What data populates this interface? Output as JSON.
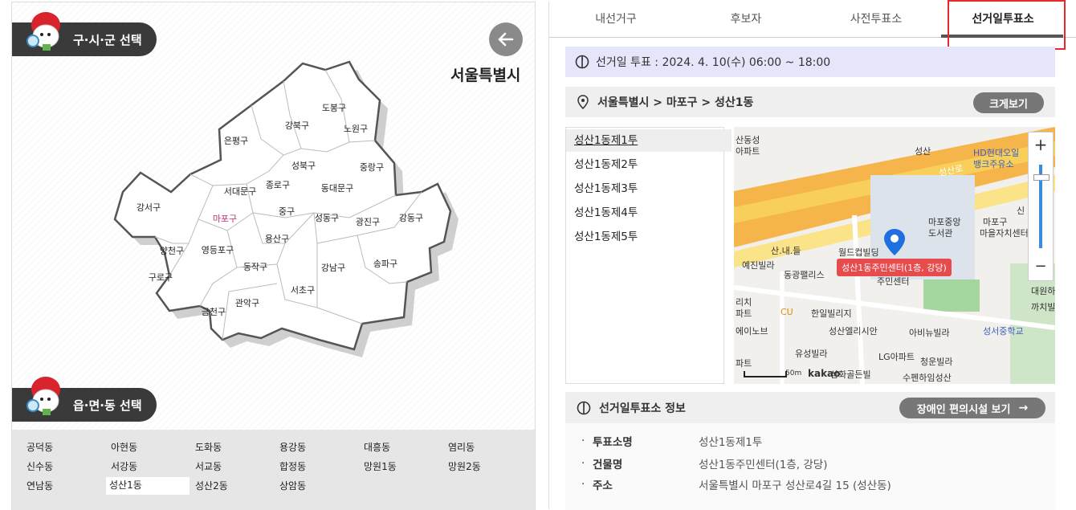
{
  "left": {
    "district_select_label": "구·시·군 선택",
    "city_title": "서울특별시",
    "dong_select_label": "읍·면·동 선택",
    "districts": [
      {
        "name": "도봉구"
      },
      {
        "name": "노원구"
      },
      {
        "name": "강북구"
      },
      {
        "name": "은평구"
      },
      {
        "name": "성북구"
      },
      {
        "name": "중랑구"
      },
      {
        "name": "종로구"
      },
      {
        "name": "동대문구"
      },
      {
        "name": "서대문구"
      },
      {
        "name": "강서구"
      },
      {
        "name": "마포구",
        "selected": true
      },
      {
        "name": "중구"
      },
      {
        "name": "성동구"
      },
      {
        "name": "광진구"
      },
      {
        "name": "강동구"
      },
      {
        "name": "용산구"
      },
      {
        "name": "영등포구"
      },
      {
        "name": "양천구"
      },
      {
        "name": "동작구"
      },
      {
        "name": "강남구"
      },
      {
        "name": "송파구"
      },
      {
        "name": "구로구"
      },
      {
        "name": "서초구"
      },
      {
        "name": "관악구"
      },
      {
        "name": "금천구"
      }
    ],
    "dongs": [
      "공덕동",
      "아현동",
      "도화동",
      "용강동",
      "대흥동",
      "염리동",
      "신수동",
      "서강동",
      "서교동",
      "합정동",
      "망원1동",
      "망원2동",
      "연남동",
      "성산1동",
      "성산2동",
      "상암동"
    ],
    "selected_dong": "성산1동"
  },
  "right": {
    "tabs": [
      "내선거구",
      "후보자",
      "사전투표소",
      "선거일투표소"
    ],
    "active_tab": "선거일투표소",
    "vote_time": "선거일 투표 : 2024. 4. 10(수) 06:00 ~ 18:00",
    "breadcrumb": "서울특별시 > 마포구 > 성산1동",
    "zoom_button": "크게보기",
    "stations": [
      "성산1동제1투",
      "성산1동제2투",
      "성산1동제3투",
      "성산1동제4투",
      "성산1동제5투"
    ],
    "selected_station": "성산1동제1투",
    "map": {
      "labels": [
        "산동성",
        "아파트",
        "성산",
        "HD현대오일",
        "뱅크주유소",
        "성산로",
        "마포중앙",
        "도서관",
        "마포구",
        "마을자치센터",
        "신",
        "산.내.들",
        "월드컵빌딩",
        "예진빌라",
        "동광팰리스",
        "주민센터",
        "리치",
        "파트",
        "CU",
        "한일빌리지",
        "대원하이",
        "까치빌",
        "에이노브",
        "성산엘리시안",
        "아비뉴빌라",
        "성서중학교",
        "유성빌라",
        "LG아파트",
        "파트",
        "청운빌라",
        "수펜하임성산",
        "삼화골든빌"
      ],
      "marker_label": "성산1동주민센터(1층, 강당)",
      "scale": "50m",
      "brand": "kakao",
      "zoom_in": "+",
      "zoom_out": "−"
    },
    "info_title": "선거일투표소 정보",
    "accessibility_button": "장애인 편의시설 보기",
    "details": [
      {
        "label": "투표소명",
        "value": "성산1동제1투"
      },
      {
        "label": "건물명",
        "value": "성산1동주민센터(1층, 강당)"
      },
      {
        "label": "주소",
        "value": "서울특별시 마포구 성산로4길 15 (성산동)"
      }
    ],
    "colors": {
      "highlight_box": "#e8282b",
      "time_bar": "#e6e6fa",
      "accent": "#333333"
    }
  }
}
